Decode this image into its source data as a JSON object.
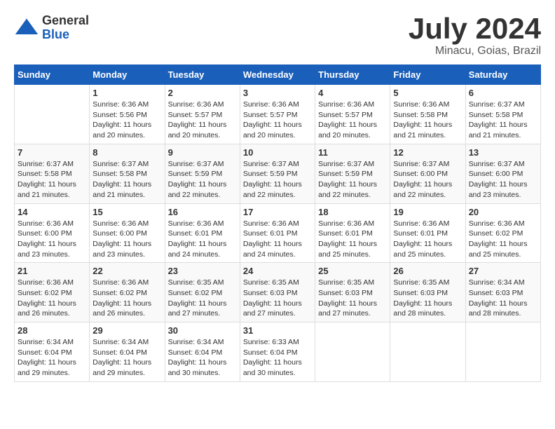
{
  "logo": {
    "general": "General",
    "blue": "Blue"
  },
  "title": "July 2024",
  "location": "Minacu, Goias, Brazil",
  "days_of_week": [
    "Sunday",
    "Monday",
    "Tuesday",
    "Wednesday",
    "Thursday",
    "Friday",
    "Saturday"
  ],
  "weeks": [
    [
      {
        "date": "",
        "info": ""
      },
      {
        "date": "1",
        "info": "Sunrise: 6:36 AM\nSunset: 5:56 PM\nDaylight: 11 hours\nand 20 minutes."
      },
      {
        "date": "2",
        "info": "Sunrise: 6:36 AM\nSunset: 5:57 PM\nDaylight: 11 hours\nand 20 minutes."
      },
      {
        "date": "3",
        "info": "Sunrise: 6:36 AM\nSunset: 5:57 PM\nDaylight: 11 hours\nand 20 minutes."
      },
      {
        "date": "4",
        "info": "Sunrise: 6:36 AM\nSunset: 5:57 PM\nDaylight: 11 hours\nand 20 minutes."
      },
      {
        "date": "5",
        "info": "Sunrise: 6:36 AM\nSunset: 5:58 PM\nDaylight: 11 hours\nand 21 minutes."
      },
      {
        "date": "6",
        "info": "Sunrise: 6:37 AM\nSunset: 5:58 PM\nDaylight: 11 hours\nand 21 minutes."
      }
    ],
    [
      {
        "date": "7",
        "info": "Sunrise: 6:37 AM\nSunset: 5:58 PM\nDaylight: 11 hours\nand 21 minutes."
      },
      {
        "date": "8",
        "info": "Sunrise: 6:37 AM\nSunset: 5:58 PM\nDaylight: 11 hours\nand 21 minutes."
      },
      {
        "date": "9",
        "info": "Sunrise: 6:37 AM\nSunset: 5:59 PM\nDaylight: 11 hours\nand 22 minutes."
      },
      {
        "date": "10",
        "info": "Sunrise: 6:37 AM\nSunset: 5:59 PM\nDaylight: 11 hours\nand 22 minutes."
      },
      {
        "date": "11",
        "info": "Sunrise: 6:37 AM\nSunset: 5:59 PM\nDaylight: 11 hours\nand 22 minutes."
      },
      {
        "date": "12",
        "info": "Sunrise: 6:37 AM\nSunset: 6:00 PM\nDaylight: 11 hours\nand 22 minutes."
      },
      {
        "date": "13",
        "info": "Sunrise: 6:37 AM\nSunset: 6:00 PM\nDaylight: 11 hours\nand 23 minutes."
      }
    ],
    [
      {
        "date": "14",
        "info": "Sunrise: 6:36 AM\nSunset: 6:00 PM\nDaylight: 11 hours\nand 23 minutes."
      },
      {
        "date": "15",
        "info": "Sunrise: 6:36 AM\nSunset: 6:00 PM\nDaylight: 11 hours\nand 23 minutes."
      },
      {
        "date": "16",
        "info": "Sunrise: 6:36 AM\nSunset: 6:01 PM\nDaylight: 11 hours\nand 24 minutes."
      },
      {
        "date": "17",
        "info": "Sunrise: 6:36 AM\nSunset: 6:01 PM\nDaylight: 11 hours\nand 24 minutes."
      },
      {
        "date": "18",
        "info": "Sunrise: 6:36 AM\nSunset: 6:01 PM\nDaylight: 11 hours\nand 25 minutes."
      },
      {
        "date": "19",
        "info": "Sunrise: 6:36 AM\nSunset: 6:01 PM\nDaylight: 11 hours\nand 25 minutes."
      },
      {
        "date": "20",
        "info": "Sunrise: 6:36 AM\nSunset: 6:02 PM\nDaylight: 11 hours\nand 25 minutes."
      }
    ],
    [
      {
        "date": "21",
        "info": "Sunrise: 6:36 AM\nSunset: 6:02 PM\nDaylight: 11 hours\nand 26 minutes."
      },
      {
        "date": "22",
        "info": "Sunrise: 6:36 AM\nSunset: 6:02 PM\nDaylight: 11 hours\nand 26 minutes."
      },
      {
        "date": "23",
        "info": "Sunrise: 6:35 AM\nSunset: 6:02 PM\nDaylight: 11 hours\nand 27 minutes."
      },
      {
        "date": "24",
        "info": "Sunrise: 6:35 AM\nSunset: 6:03 PM\nDaylight: 11 hours\nand 27 minutes."
      },
      {
        "date": "25",
        "info": "Sunrise: 6:35 AM\nSunset: 6:03 PM\nDaylight: 11 hours\nand 27 minutes."
      },
      {
        "date": "26",
        "info": "Sunrise: 6:35 AM\nSunset: 6:03 PM\nDaylight: 11 hours\nand 28 minutes."
      },
      {
        "date": "27",
        "info": "Sunrise: 6:34 AM\nSunset: 6:03 PM\nDaylight: 11 hours\nand 28 minutes."
      }
    ],
    [
      {
        "date": "28",
        "info": "Sunrise: 6:34 AM\nSunset: 6:04 PM\nDaylight: 11 hours\nand 29 minutes."
      },
      {
        "date": "29",
        "info": "Sunrise: 6:34 AM\nSunset: 6:04 PM\nDaylight: 11 hours\nand 29 minutes."
      },
      {
        "date": "30",
        "info": "Sunrise: 6:34 AM\nSunset: 6:04 PM\nDaylight: 11 hours\nand 30 minutes."
      },
      {
        "date": "31",
        "info": "Sunrise: 6:33 AM\nSunset: 6:04 PM\nDaylight: 11 hours\nand 30 minutes."
      },
      {
        "date": "",
        "info": ""
      },
      {
        "date": "",
        "info": ""
      },
      {
        "date": "",
        "info": ""
      }
    ]
  ]
}
